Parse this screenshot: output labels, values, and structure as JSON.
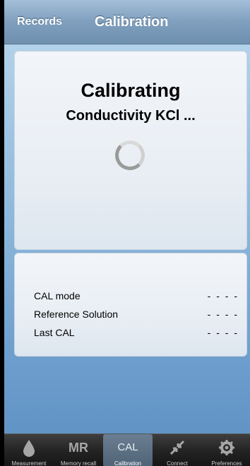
{
  "navbar": {
    "back_label": "Records",
    "title": "Calibration"
  },
  "calibration": {
    "heading": "Calibrating",
    "subheading": "Conductivity KCl ..."
  },
  "info": {
    "rows": [
      {
        "label": "CAL mode",
        "value": "- - - -"
      },
      {
        "label": "Reference Solution",
        "value": "- - - -"
      },
      {
        "label": "Last CAL",
        "value": "- - - -"
      }
    ]
  },
  "tabbar": {
    "tabs": [
      {
        "icon": "drop-icon",
        "icon_text": "",
        "label": "Measurement"
      },
      {
        "icon": "memory-recall-icon",
        "icon_text": "MR",
        "label": "Memory recall"
      },
      {
        "icon": "calibration-icon",
        "icon_text": "CAL",
        "label": "Calibration",
        "active": true
      },
      {
        "icon": "connect-arrows-icon",
        "icon_text": "",
        "label": "Connect"
      },
      {
        "icon": "gear-icon",
        "icon_text": "",
        "label": "Preferences"
      }
    ]
  },
  "colors": {
    "accent_tab": "#5b7087",
    "navbar": "#7f9fbe"
  }
}
